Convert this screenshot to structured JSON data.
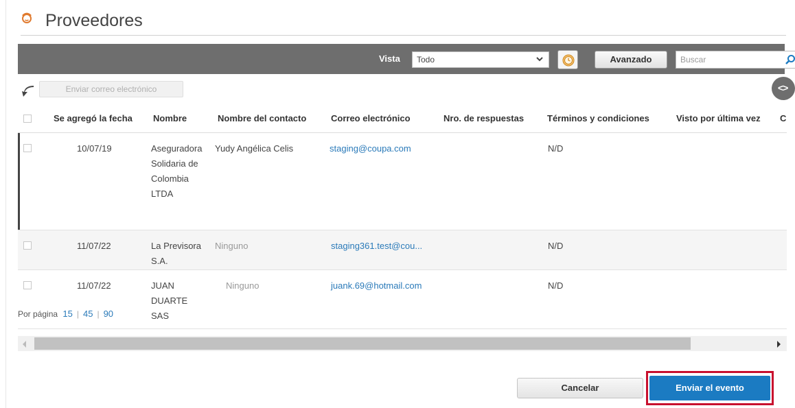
{
  "header": {
    "title": "Proveedores",
    "icon": "supplier-person-icon"
  },
  "toolbar": {
    "vista_label": "Vista",
    "vista_value": "Todo",
    "advanced_label": "Avanzado",
    "search_placeholder": "Buscar"
  },
  "actions": {
    "email_label": "Enviar correo electrónico"
  },
  "table": {
    "headers": {
      "date": "Se agregó la fecha",
      "name": "Nombre",
      "contact": "Nombre del contacto",
      "email": "Correo electrónico",
      "responses": "Nro. de respuestas",
      "terms": "Términos y condiciones",
      "last_seen": "Visto por última vez",
      "overflow": "C"
    },
    "rows": [
      {
        "date": "10/07/19",
        "name": "Aseguradora Solidaria de Colombia LTDA",
        "contact": "Yudy Angélica Celis",
        "email": "staging@coupa.com",
        "terms": "N/D"
      },
      {
        "date": "11/07/22",
        "name": "La Previsora S.A.",
        "contact": "Ninguno",
        "email": "staging361.test@cou...",
        "terms": "N/D"
      },
      {
        "date": "11/07/22",
        "name": "JUAN DUARTE SAS",
        "contact": "Ninguno",
        "email": "juank.69@hotmail.com",
        "terms": "N/D"
      }
    ]
  },
  "pagination": {
    "label": "Por página",
    "options": [
      "15",
      "45",
      "90"
    ]
  },
  "footer": {
    "cancel_label": "Cancelar",
    "send_label": "Enviar el evento"
  },
  "colors": {
    "toolbar_bg": "#6e6e6e",
    "link": "#2a7ab9",
    "primary": "#1b7bc2",
    "highlight": "#c8102e"
  }
}
